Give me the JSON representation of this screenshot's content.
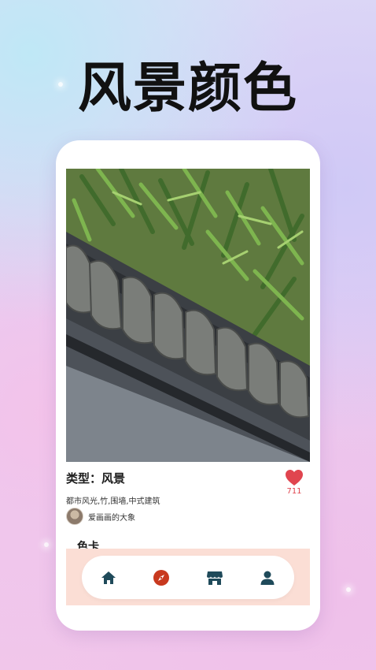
{
  "headline": "风景颜色",
  "card": {
    "type_label": "类型：风景",
    "tags": "都市风光,竹,围墙,中式建筑",
    "author_name": "爱画画的大象",
    "likes": "711",
    "section_title": "色卡"
  },
  "nav": {
    "items": [
      {
        "icon": "home-icon"
      },
      {
        "icon": "compass-icon"
      },
      {
        "icon": "store-icon"
      },
      {
        "icon": "user-icon"
      }
    ]
  },
  "colors": {
    "accent_red": "#e0454f",
    "icon_dark": "#1f4a5a",
    "compass_red": "#c8391e",
    "band_pink": "#fbded5"
  }
}
